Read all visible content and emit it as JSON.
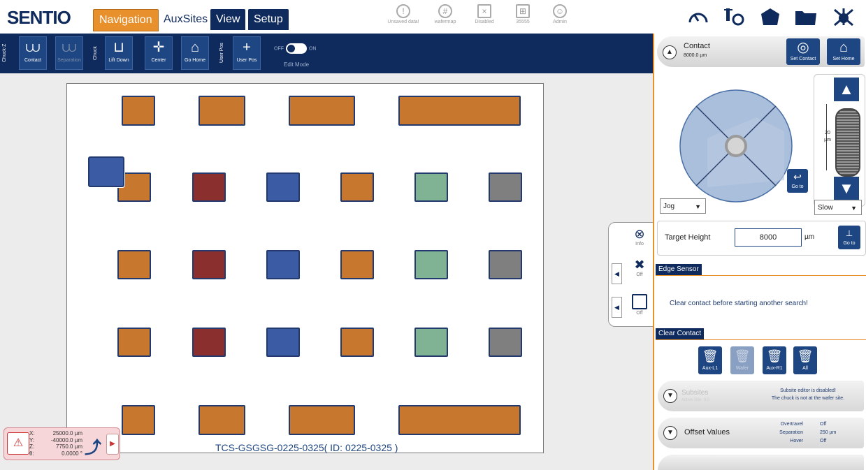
{
  "app": {
    "logo": "SENTIO"
  },
  "tabs": {
    "navigation": "Navigation",
    "auxsites": "AuxSites",
    "view": "View",
    "setup": "Setup"
  },
  "status": [
    {
      "label": "Unsaved data!",
      "icon": "exclamation-icon"
    },
    {
      "label": "wafermap",
      "icon": "wafer-icon"
    },
    {
      "label": "Disabled",
      "icon": "disabled-icon"
    },
    {
      "label": "35555",
      "icon": "network-icon"
    },
    {
      "label": "Admin",
      "icon": "user-icon"
    }
  ],
  "toolbar": {
    "chuck_z": "Chuck-Z",
    "chuck": "Chuck",
    "user_pos_group": "User Pos",
    "contact": "Contact",
    "separation": "Separation",
    "lift_down": "Lift Down",
    "center": "Center",
    "go_home": "Go Home",
    "user_pos": "User Pos",
    "toggle_off": "OFF",
    "toggle_on": "ON",
    "edit_mode": "Edit Mode"
  },
  "wafer": {
    "label": "TCS-GSGSG-0225-0325( ID: 0225-0325 )"
  },
  "colors": {
    "orange": "#c8772e",
    "red": "#8b2e2e",
    "blue": "#3b5ba5",
    "green": "#7fb394",
    "gray": "#7f7f7f"
  },
  "coords": {
    "x": "25000.0 µm",
    "y": "-40000.0 µm",
    "z": "7750.0 µm",
    "theta": "0.0000 °",
    "x_label": "X:",
    "y_label": "Y:",
    "z_label": "Z:",
    "theta_label": "θ:"
  },
  "side": {
    "info": "Info",
    "off1": "Off",
    "off2": "Off"
  },
  "right": {
    "contact_title": "Contact",
    "contact_value": "8000.0 µm",
    "set_contact": "Set Contact",
    "set_home": "Set Home",
    "go_to": "Go to",
    "step_value": "20",
    "step_unit": "µm",
    "jog": "Jog",
    "speed": "Slow",
    "target_height_label": "Target Height",
    "target_height_value": "8000",
    "target_unit": "µm",
    "go_to2": "Go to",
    "edge_sensor": "Edge Sensor",
    "edge_message": "Clear contact before starting another search!",
    "clear_contact": "Clear Contact",
    "clear_buttons": [
      "Aux-L1",
      "Wafer",
      "Aux-R1",
      "All"
    ],
    "subsites": "Subsites",
    "subsites_sub": "Active Site: 0,0",
    "subsite_msg1": "Subsite editor is disabled!",
    "subsite_msg2": "The chuck is not at the wafer site.",
    "offset_values": "Offset Values",
    "overtravel": "Overtravel",
    "overtravel_val": "Off",
    "separation": "Separation",
    "separation_val": "250 µm",
    "hover": "Hover",
    "hover_val": "Off"
  }
}
